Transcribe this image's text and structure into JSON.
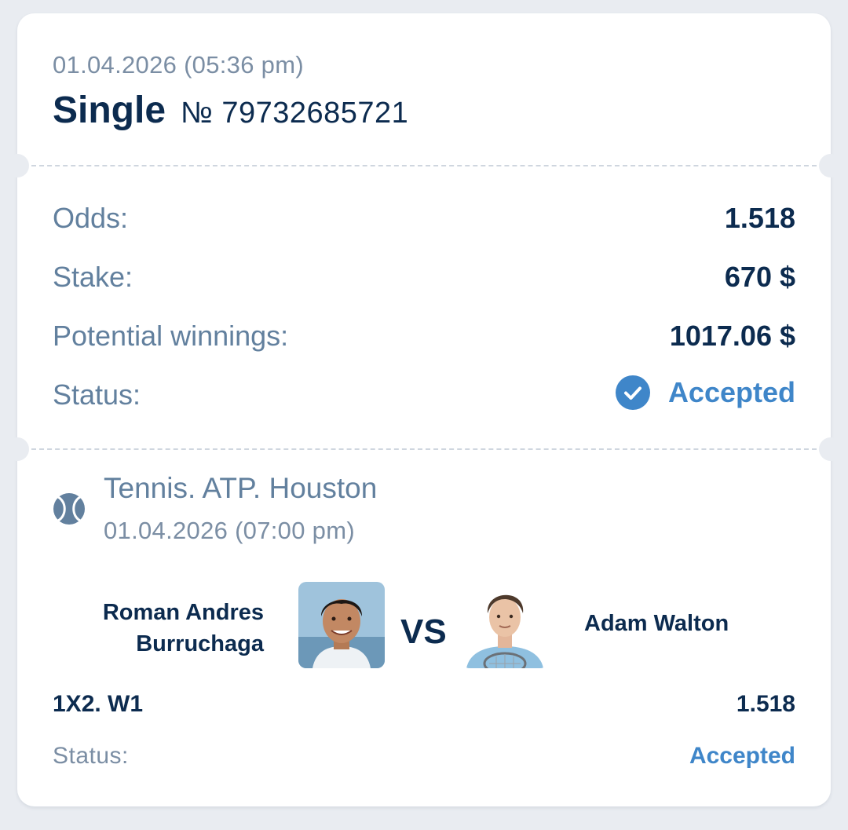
{
  "header": {
    "datetime": "01.04.2026 (05:36 pm)",
    "bet_type": "Single",
    "bet_number": "№ 79732685721"
  },
  "summary": {
    "odds_label": "Odds:",
    "odds_value": "1.518",
    "stake_label": "Stake:",
    "stake_value": "670 $",
    "winnings_label": "Potential winnings:",
    "winnings_value": "1017.06 $",
    "status_label": "Status:",
    "status_value": "Accepted",
    "status_icon": "check-circle-icon"
  },
  "event": {
    "sport_icon": "tennis-ball-icon",
    "title": "Tennis. ATP. Houston",
    "datetime": "01.04.2026 (07:00 pm)",
    "team1_name_line1": "Roman Andres",
    "team1_name_line2": "Burruchaga",
    "vs": "VS",
    "team2_name": "Adam Walton"
  },
  "selection": {
    "market": "1X2. W1",
    "odds": "1.518",
    "status_label": "Status:",
    "status_value": "Accepted"
  },
  "colors": {
    "background": "#e9ecf1",
    "card": "#ffffff",
    "primary_text": "#0c2b4f",
    "secondary_text": "#62809e",
    "accent": "#3f86c9"
  }
}
